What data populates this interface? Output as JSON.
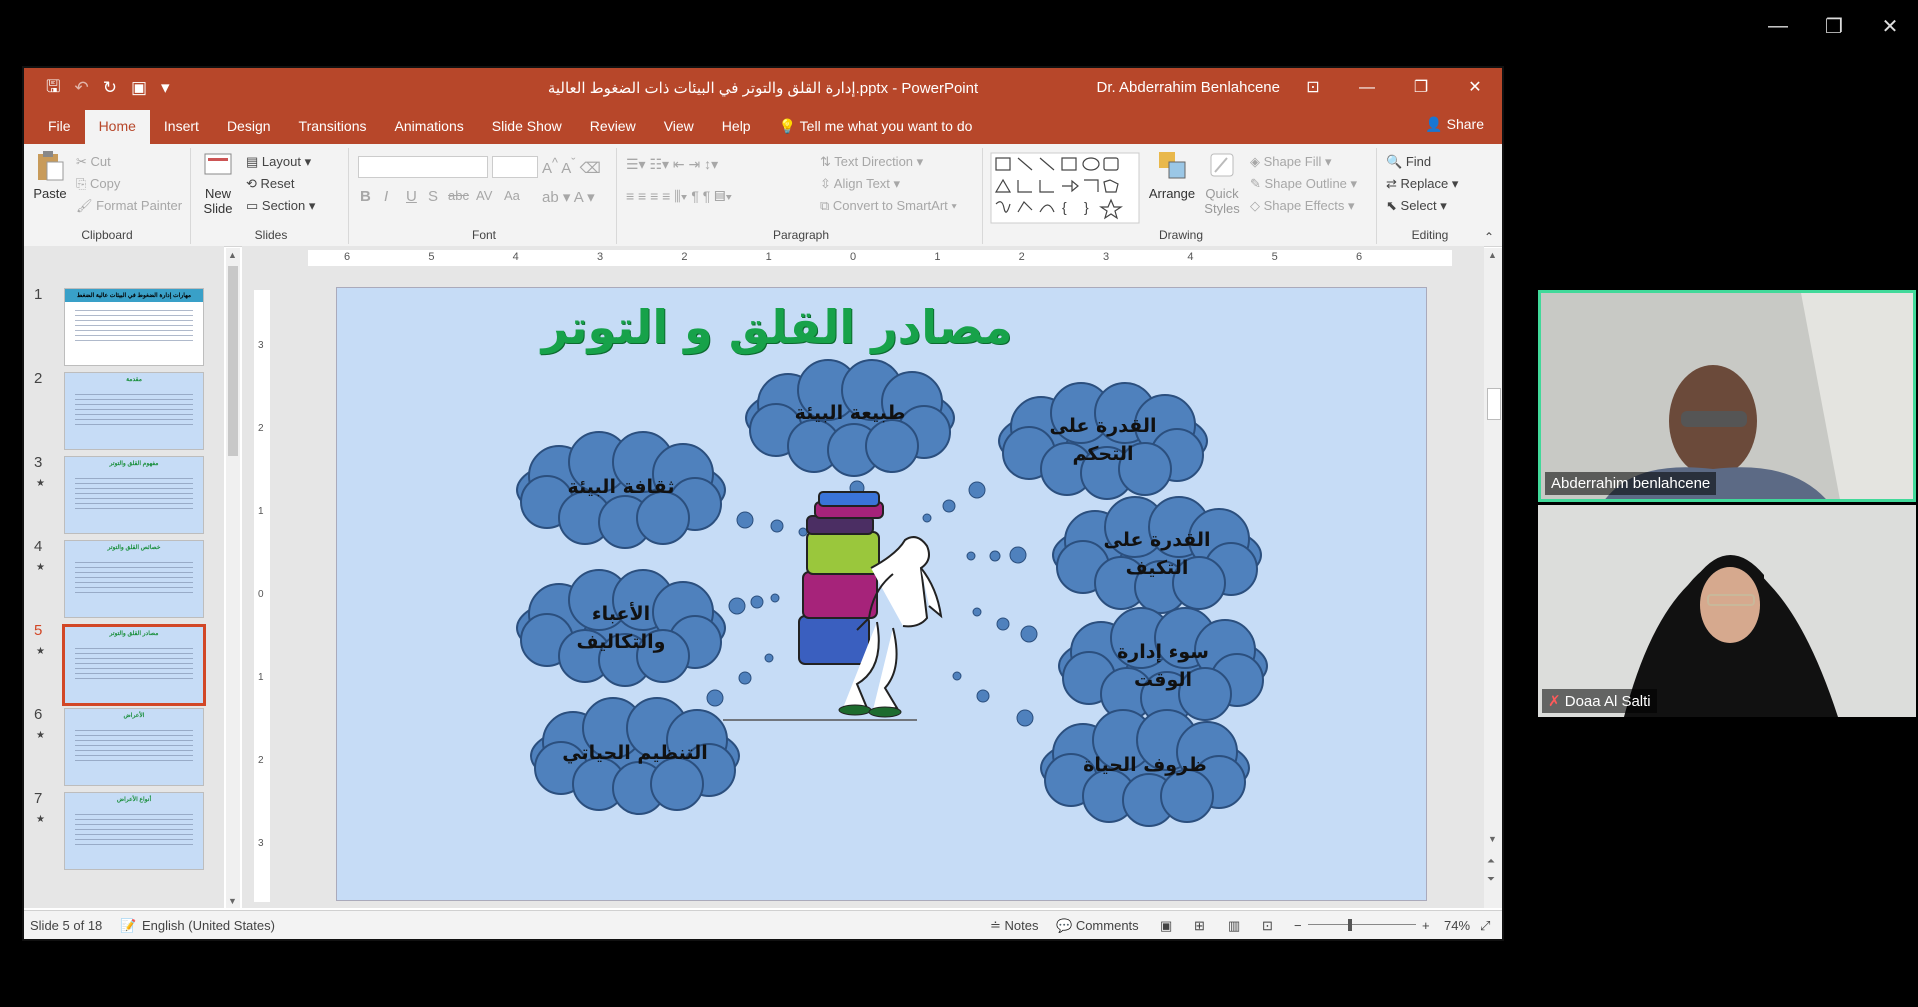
{
  "desktop": {
    "minimize": "—",
    "restore": "❐",
    "close": "✕"
  },
  "ppt": {
    "title": "إدارة القلق والتوتر في البيئات ذات الضغوط العالية.pptx  -  PowerPoint",
    "user": "Dr. Abderrahim Benlahcene",
    "qat": {
      "save": "🖫",
      "undo": "↶",
      "redo": "↻",
      "present": "▣",
      "more": "▾"
    },
    "tabs": [
      "File",
      "Home",
      "Insert",
      "Design",
      "Transitions",
      "Animations",
      "Slide Show",
      "Review",
      "View",
      "Help"
    ],
    "tell_me": "Tell me what you want to do",
    "share": "Share",
    "ribbon": {
      "clipboard": {
        "paste": "Paste",
        "cut": "Cut",
        "copy": "Copy",
        "format_painter": "Format Painter",
        "label": "Clipboard"
      },
      "slides": {
        "new_slide": "New Slide",
        "layout": "Layout",
        "reset": "Reset",
        "section": "Section",
        "label": "Slides"
      },
      "font": {
        "bold": "B",
        "italic": "I",
        "underline": "U",
        "shadow": "S",
        "strike": "abc",
        "spacing": "AV",
        "case": "Aa",
        "label": "Font"
      },
      "paragraph": {
        "text_direction": "Text Direction",
        "align_text": "Align Text",
        "smartart": "Convert to SmartArt",
        "label": "Paragraph"
      },
      "drawing": {
        "arrange": "Arrange",
        "quick_styles": "Quick Styles",
        "shape_fill": "Shape Fill",
        "shape_outline": "Shape Outline",
        "shape_effects": "Shape Effects",
        "label": "Drawing"
      },
      "editing": {
        "find": "Find",
        "replace": "Replace",
        "select": "Select",
        "label": "Editing"
      }
    },
    "ruler_ticks": [
      "6",
      "5",
      "4",
      "3",
      "2",
      "1",
      "0",
      "1",
      "2",
      "3",
      "4",
      "5",
      "6"
    ],
    "vruler_ticks": [
      "3",
      "2",
      "1",
      "0",
      "1",
      "2",
      "3"
    ],
    "thumbnails": [
      {
        "num": "1",
        "star": "",
        "title": "مهارات إدارة الضغوط في البيئات عالية الضغط"
      },
      {
        "num": "2",
        "star": "",
        "title": "مقدمة"
      },
      {
        "num": "3",
        "star": "★",
        "title": "مفهوم القلق والتوتر"
      },
      {
        "num": "4",
        "star": "★",
        "title": "خصائص القلق والتوتر"
      },
      {
        "num": "5",
        "star": "★",
        "title": "مصادر القلق والتوتر"
      },
      {
        "num": "6",
        "star": "★",
        "title": "الأعراض"
      },
      {
        "num": "7",
        "star": "★",
        "title": "أنواع الأعراض"
      }
    ],
    "slide": {
      "title": "مصادر القلق و التوتر",
      "clouds": {
        "c1": "طبيعة البيئة",
        "c2a": "القدرة على",
        "c2b": "التحكم",
        "c3": "ثقافة البيئة",
        "c4a": "القدرة على",
        "c4b": "التكيف",
        "c5a": "الأعباء",
        "c5b": "والتكاليف",
        "c6a": "سوء إدارة",
        "c6b": "الوقت",
        "c7": "التنظيم الحياتي",
        "c8": "ظروف الحياة"
      },
      "colors": {
        "bg": "#c6dcf6",
        "title": "#17a24a",
        "cloud": "#4f81bd",
        "cloud_stroke": "#2b4f7e"
      }
    },
    "status": {
      "slide": "Slide 5 of 18",
      "language": "English (United States)",
      "notes": "Notes",
      "comments": "Comments",
      "zoom": "74%"
    }
  },
  "video": {
    "p1": "Abderrahim benlahcene",
    "p2": "Doaa Al Salti"
  }
}
